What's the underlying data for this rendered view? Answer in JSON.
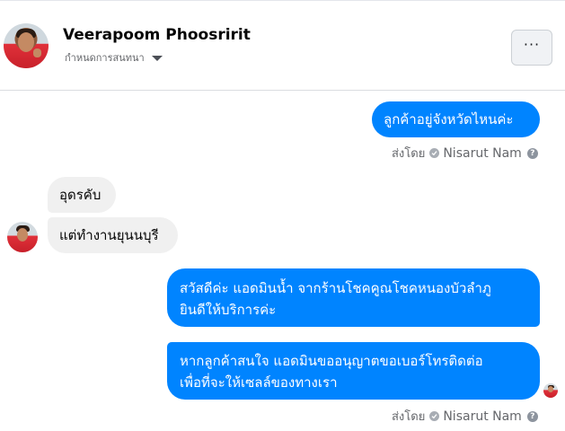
{
  "header": {
    "name": "Veerapoom Phoosririt",
    "subtitle": "กำหนดการสนทนา",
    "more_label": "···"
  },
  "messages": [
    {
      "direction": "outgoing",
      "text": "ลูกค้าอยู่จังหวัดไหนค่ะ"
    },
    {
      "direction": "incoming",
      "text": "อุดรคับ"
    },
    {
      "direction": "incoming",
      "text": "แต่ทำงานยุนนบุรี"
    },
    {
      "direction": "outgoing",
      "lines": [
        "สวัสดีค่ะ แอดมินน้ำ จากร้านโชคคูณโชคหนองบัวลำภู",
        "ยินดีให้บริการค่ะ"
      ]
    },
    {
      "direction": "outgoing",
      "lines": [
        "หากลูกค้าสนใจ แอดมินขออนุญาตขอเบอร์โทรติดต่อ",
        "เพื่อที่จะให้เซลล์ของทางเรา"
      ]
    }
  ],
  "sent_by": {
    "prefix": "ส่งโดย",
    "sender": "Nisarut Nam",
    "help": "?"
  },
  "colors": {
    "outgoing_bubble": "#0084ff",
    "incoming_bubble": "#f0f0f0",
    "secondary_text": "#65676b"
  },
  "icons": {
    "more": "more-horizontal-icon",
    "caret": "caret-down-icon",
    "verified": "check-circle-icon",
    "help": "question-circle-icon"
  }
}
